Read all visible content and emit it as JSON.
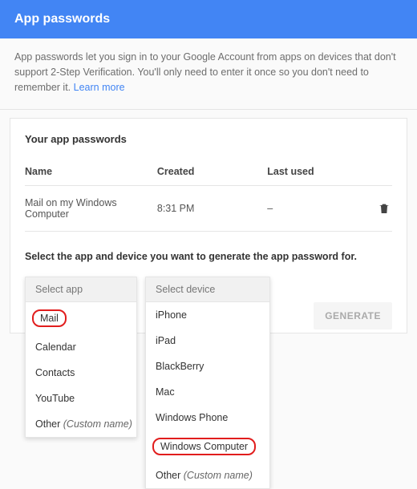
{
  "header": {
    "title": "App passwords"
  },
  "intro": {
    "text": "App passwords let you sign in to your Google Account from apps on devices that don't support 2-Step Verification. You'll only need to enter it once so you don't need to remember it. ",
    "link": "Learn more"
  },
  "card": {
    "title": "Your app passwords",
    "columns": {
      "name": "Name",
      "created": "Created",
      "last_used": "Last used"
    },
    "rows": [
      {
        "name": "Mail on my Windows Computer",
        "created": "8:31 PM",
        "last_used": "–"
      }
    ],
    "instruction": "Select the app and device you want to generate the app password for.",
    "select_app": {
      "header": "Select app",
      "items": [
        "Mail",
        "Calendar",
        "Contacts",
        "YouTube"
      ],
      "other_prefix": "Other ",
      "other_em": "(Custom name)"
    },
    "select_device": {
      "header": "Select device",
      "items": [
        "iPhone",
        "iPad",
        "BlackBerry",
        "Mac",
        "Windows Phone",
        "Windows Computer"
      ],
      "other_prefix": "Other ",
      "other_em": "(Custom name)"
    },
    "generate": "GENERATE"
  }
}
